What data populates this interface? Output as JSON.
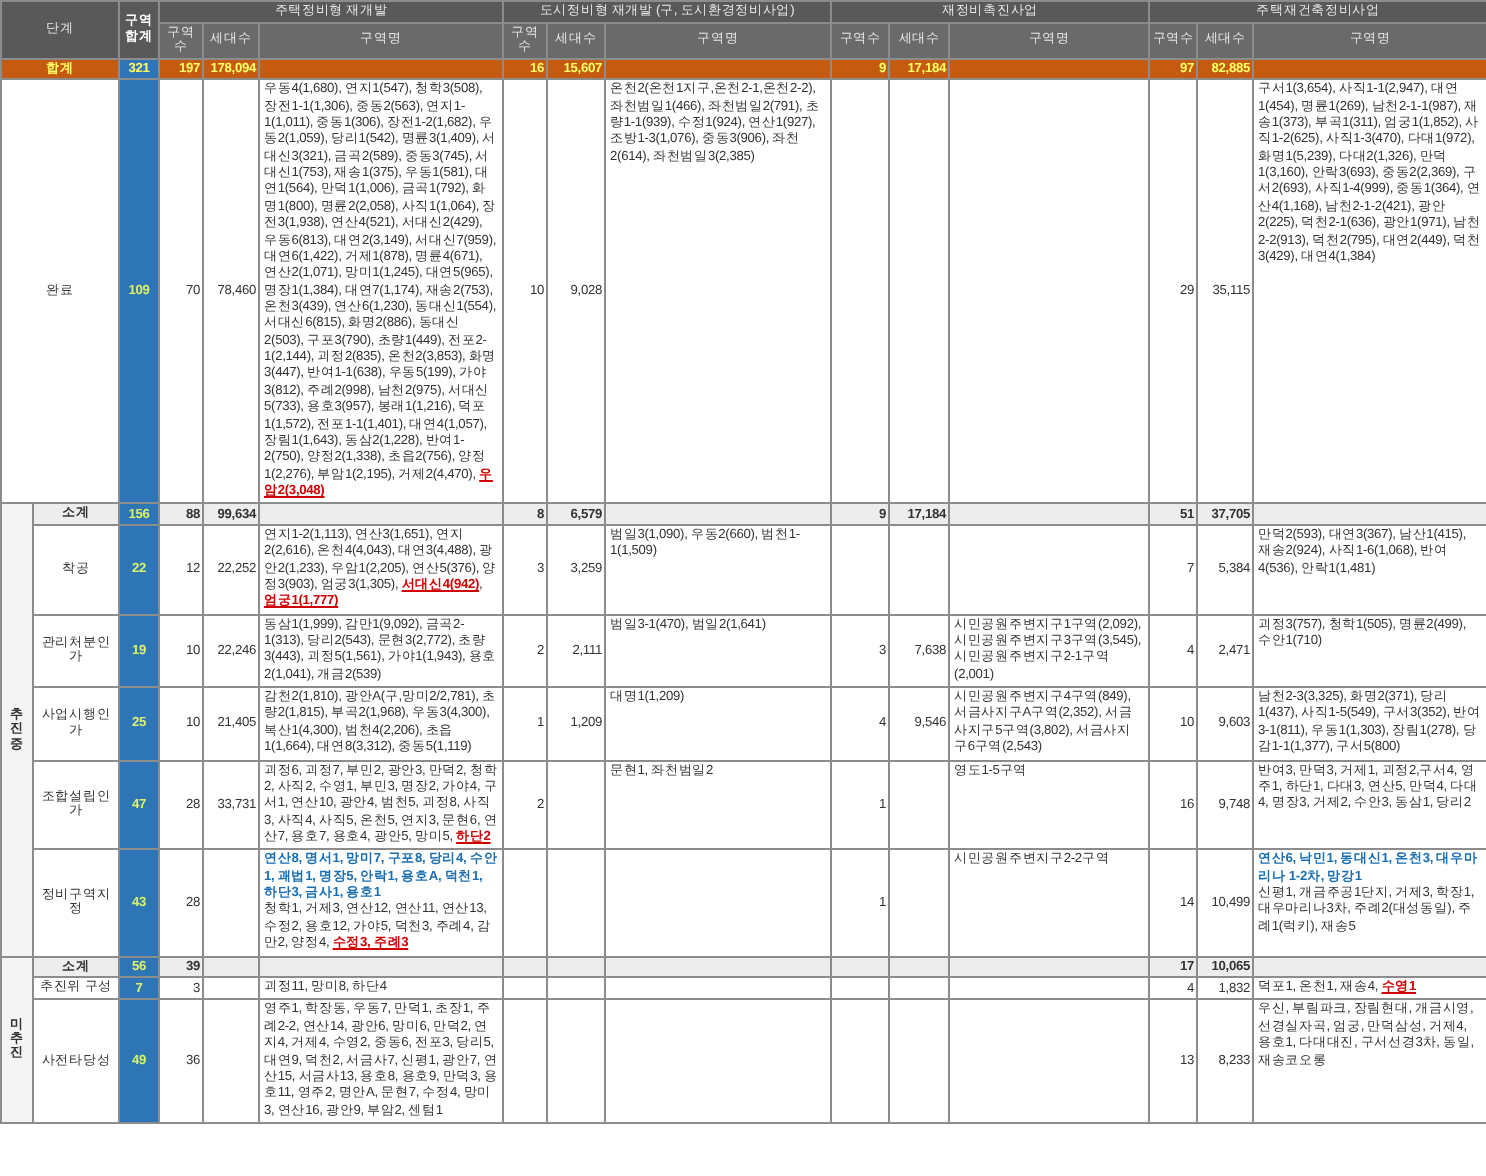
{
  "header": {
    "stage": "단계",
    "zone_total": "구역 합계"
  },
  "programs": [
    {
      "title": "주택정비형 재개발",
      "sub_headers": [
        "구역수",
        "세대수",
        "구역명"
      ]
    },
    {
      "title": "도시정비형 재개발 (구, 도시환경정비사업)",
      "sub_headers": [
        "구역수",
        "세대수",
        "구역명"
      ]
    },
    {
      "title": "재정비촉진사업",
      "sub_headers": [
        "구역수",
        "세대수",
        "구역명"
      ]
    },
    {
      "title": "주택재건축정비사업",
      "sub_headers": [
        "구역수",
        "세대수",
        "구역명"
      ]
    }
  ],
  "total": {
    "label": "합계",
    "zones": "321",
    "cells": [
      {
        "count": "197",
        "households": "178,094"
      },
      {
        "count": "16",
        "households": "15,607"
      },
      {
        "count": "9",
        "households": "17,184"
      },
      {
        "count": "97",
        "households": "82,885"
      }
    ]
  },
  "completed": {
    "label": "완료",
    "zones": "109",
    "cells": [
      {
        "count": "70",
        "households": "78,460",
        "districts": [
          [
            {
              "kind": "plain",
              "text": "우동4(1,680), 연지1(547), 청학3(508), 장전1-1(1,306), 중동2(563), 연지1-1(1,011), 중동1(306), 장전1-2(1,682), 우동2(1,059), 당리1(542), 명륜3(1,409), 서대신3(321), 금곡2(589), 중동3(745), 서대신1(753), 재송1(375), 우동1(581), 대연1(564), 만덕1(1,006), 금곡1(792), 화명1(800), 명륜2(2,058), 사직1(1,064), 장전3(1,938), 연산4(521), 서대신2(429), 우동6(813), 대연2(3,149), 서대신7(959), 대연6(1,422), 거제1(878), 명륜4(671), 연산2(1,071), 망미1(1,245), 대연5(965), 명장1(1,384), 대연7(1,174), 재송2(753), 온천3(439), 연산6(1,230), 동대신1(554), 서대신6(815), 화명2(886), 동대신2(503), 구포3(790), 초량1(449), 전포2-1(2,144), 괴정2(835), 온천2(3,853), 화명3(447), 반여1-1(638), 우동5(199), 가야3(812), 주례2(998), 남천2(975), 서대신5(733), 용호3(957), 봉래1(1,216), 덕포1(1,572), 전포1-1(1,401), 대연4(1,057), 장림1(1,643), 동삼2(1,228), 반여1-2(750), 양정2(1,338), 초읍2(756), 양정1(2,276), 부암1(2,195), 거제2(4,470), "
            },
            {
              "kind": "flagged",
              "text": "우암2(3,048)"
            }
          ]
        ]
      },
      {
        "count": "10",
        "households": "9,028",
        "districts": [
          [
            {
              "kind": "plain",
              "text": "온천2(온천1지구,온천2-1,온천2-2), 좌천범일1(466), 좌천범일2(791), 초량1-1(939), 수정1(924), 연산1(927), 조방1-3(1,076), 중동3(906), 좌천2(614), 좌천범일3(2,385)"
            }
          ]
        ]
      },
      {},
      {
        "count": "29",
        "households": "35,115",
        "districts": [
          [
            {
              "kind": "plain",
              "text": "구서1(3,654), 사직1-1(2,947), 대연1(454), 명륜1(269), 남천2-1-1(987), 재송1(373), 부곡1(311), 엄궁1(1,852), 사직1-2(625), 사직1-3(470), 다대1(972), 화명1(5,239), 다대2(1,326), 만덕1(3,160), 안락3(693), 중동2(2,369), 구서2(693), 사직1-4(999), 중동1(364), 연산4(1,168), 남천2-1-2(421), 광안2(225), 덕천2-1(636), 광안1(971), 남천2-2(913), 덕천2(795), 대연2(449), 덕천3(429), 대연4(1,384)"
            }
          ]
        ]
      }
    ]
  },
  "groups": [
    {
      "label": "추진중",
      "subtotal": {
        "label": "소계",
        "zones": "156",
        "cells": [
          {
            "count": "88",
            "households": "99,634"
          },
          {
            "count": "8",
            "households": "6,579"
          },
          {
            "count": "9",
            "households": "17,184"
          },
          {
            "count": "51",
            "households": "37,705"
          }
        ]
      },
      "rows": [
        {
          "label": "착공",
          "zones": "22",
          "cells": [
            {
              "count": "12",
              "households": "22,252",
              "districts": [
                [
                  {
                    "kind": "plain",
                    "text": "연지1-2(1,113), 연산3(1,651), 연지2(2,616), 온천4(4,043), 대연3(4,488), 광안2(1,233), 우암1(2,205), 연산5(376), 양정3(903), 엄궁3(1,305), "
                  },
                  {
                    "kind": "flagged",
                    "text": "서대신4(942)"
                  },
                  {
                    "kind": "plain",
                    "text": ", "
                  },
                  {
                    "kind": "flagged",
                    "text": "엄궁1(1,777)"
                  }
                ]
              ]
            },
            {
              "count": "3",
              "households": "3,259",
              "districts": [
                [
                  {
                    "kind": "plain",
                    "text": "범일3(1,090), 우동2(660), 범천1-1(1,509)"
                  }
                ]
              ]
            },
            {},
            {
              "count": "7",
              "households": "5,384",
              "districts": [
                [
                  {
                    "kind": "plain",
                    "text": "만덕2(593), 대연3(367), 남산1(415), 재송2(924), 사직1-6(1,068), 반여4(536), 안락1(1,481)"
                  }
                ]
              ]
            }
          ]
        },
        {
          "label": "관리처분인가",
          "zones": "19",
          "cells": [
            {
              "count": "10",
              "households": "22,246",
              "districts": [
                [
                  {
                    "kind": "plain",
                    "text": "동삼1(1,999), 감만1(9,092), 금곡2-1(313), 당리2(543), 문현3(2,772), 초량3(443), 괴정5(1,561), 가야1(1,943), 용호2(1,041), 개금2(539)"
                  }
                ]
              ]
            },
            {
              "count": "2",
              "households": "2,111",
              "districts": [
                [
                  {
                    "kind": "plain",
                    "text": "범일3-1(470), 범일2(1,641)"
                  }
                ]
              ]
            },
            {
              "count": "3",
              "households": "7,638",
              "districts": [
                [
                  {
                    "kind": "plain",
                    "text": "시민공원주변지구1구역(2,092), 시민공원주변지구3구역(3,545), 시민공원주변지구2-1구역(2,001)"
                  }
                ]
              ]
            },
            {
              "count": "4",
              "households": "2,471",
              "districts": [
                [
                  {
                    "kind": "plain",
                    "text": "괴정3(757), 청학1(505), 명륜2(499), 수안1(710)"
                  }
                ]
              ]
            }
          ]
        },
        {
          "label": "사업시행인가",
          "zones": "25",
          "cells": [
            {
              "count": "10",
              "households": "21,405",
              "districts": [
                [
                  {
                    "kind": "plain",
                    "text": "감천2(1,810), 광안A(구,망미2/2,781), 초량2(1,815), 부곡2(1,968), 우동3(4,300), 복산1(4,300), 범천4(2,206), 초읍1(1,664), 대연8(3,312), 중동5(1,119)"
                  }
                ]
              ]
            },
            {
              "count": "1",
              "households": "1,209",
              "districts": [
                [
                  {
                    "kind": "plain",
                    "text": "대명1(1,209)"
                  }
                ]
              ]
            },
            {
              "count": "4",
              "households": "9,546",
              "districts": [
                [
                  {
                    "kind": "plain",
                    "text": "시민공원주변지구4구역(849), 서금사지구A구역(2,352), 서금사지구5구역(3,802), 서금사지구6구역(2,543)"
                  }
                ]
              ]
            },
            {
              "count": "10",
              "households": "9,603",
              "districts": [
                [
                  {
                    "kind": "plain",
                    "text": "남천2-3(3,325), 화명2(371), 당리1(437), 사직1-5(549), 구서3(352), 반여3-1(811), 우동1(1,303), 장림1(278), 당감1-1(1,377), 구서5(800)"
                  }
                ]
              ]
            }
          ]
        },
        {
          "label": "조합설립인가",
          "zones": "47",
          "cells": [
            {
              "count": "28",
              "households": "33,731",
              "districts": [
                [
                  {
                    "kind": "plain",
                    "text": "괴정6, 괴정7, 부민2, 광안3, 만덕2, 청학2, 사직2, 수영1, 부민3, 명장2, 가야4, 구서1, 연산10, 광안4, 범천5, 괴정8, 사직3, 사직4, 사직5, 온천5, 연지3, 문현6, 연산7, 용호7, 용호4, 광안5, 망미5, "
                  },
                  {
                    "kind": "flagged",
                    "text": "하단2"
                  }
                ]
              ]
            },
            {
              "count": "2",
              "districts": [
                [
                  {
                    "kind": "plain",
                    "text": "문현1, 좌천범일2"
                  }
                ]
              ]
            },
            {
              "count": "1",
              "districts": [
                [
                  {
                    "kind": "plain",
                    "text": "영도1-5구역"
                  }
                ]
              ]
            },
            {
              "count": "16",
              "households": "9,748",
              "districts": [
                [
                  {
                    "kind": "plain",
                    "text": "반여3, 만덕3, 거제1, 괴정2,구서4, 영주1, 하단1, 다대3, 연산5, 만덕4, 다대4, 명장3, 거제2, 수안3, 동삼1, 당리2"
                  }
                ]
              ]
            }
          ]
        },
        {
          "label": "정비구역지정",
          "zones": "43",
          "cells": [
            {
              "count": "28",
              "districts": [
                [
                  {
                    "kind": "new",
                    "text": "연산8, 명서1, 망미7, 구포8, 당리4, 수안1, 괘법1, 명장5, 안락1, 용호A, 덕천1, 하단3, 금사1, 용호1"
                  }
                ],
                [
                  {
                    "kind": "plain",
                    "text": "청학1, 거제3, 연산12, 연산11, 연산13, 수정2, 용호12, 가야5, 덕천3, 주례4, 감만2, 양정4, "
                  },
                  {
                    "kind": "flagged",
                    "text": "수정3, 주례3"
                  }
                ]
              ]
            },
            {},
            {
              "count": "1",
              "districts": [
                [
                  {
                    "kind": "plain",
                    "text": "시민공원주변지구2-2구역"
                  }
                ]
              ]
            },
            {
              "count": "14",
              "households": "10,499",
              "districts": [
                [
                  {
                    "kind": "new",
                    "text": "연산6, 낙민1, 동대신1, 온천3, 대우마리나 1-2차, 망강1"
                  }
                ],
                [
                  {
                    "kind": "plain",
                    "text": "신평1, 개금주공1단지, 거제3, 학장1, 대우마리나3차, 주례2(대성동일), 주례1(럭키), 재송5"
                  }
                ]
              ]
            }
          ]
        }
      ]
    },
    {
      "label": "미추진",
      "subtotal": {
        "label": "소계",
        "zones": "56",
        "cells": [
          {
            "count": "39"
          },
          {},
          {},
          {
            "count": "17",
            "households": "10,065"
          }
        ]
      },
      "rows": [
        {
          "label": "추진위 구성",
          "zones": "7",
          "cells": [
            {
              "count": "3",
              "districts": [
                [
                  {
                    "kind": "plain",
                    "text": "괴정11, 망미8, 하단4"
                  }
                ]
              ]
            },
            {},
            {},
            {
              "count": "4",
              "households": "1,832",
              "districts": [
                [
                  {
                    "kind": "plain",
                    "text": "덕포1, 온천1, 재송4, "
                  },
                  {
                    "kind": "flagged",
                    "text": "수영1"
                  }
                ]
              ]
            }
          ]
        },
        {
          "label": "사전타당성",
          "zones": "49",
          "cells": [
            {
              "count": "36",
              "districts": [
                [
                  {
                    "kind": "plain",
                    "text": "영주1, 학장동, 우동7, 만덕1, 초장1, 주례2-2, 연산14, 광안6, 망미6, 만덕2, 연지4, 거제4, 수영2, 중동6, 전포3, 당리5, 대연9, 덕천2, 서금사7, 신평1, 광안7, 연산15, 서금사13, 용호8, 용호9, 만덕3, 용호11, 영주2, 명안A, 문현7, 수정4, 망미3, 연산16, 광안9, 부암2, 센텀1"
                  }
                ]
              ]
            },
            {},
            {},
            {
              "count": "13",
              "households": "8,233",
              "districts": [
                [
                  {
                    "kind": "plain",
                    "text": "우신, 부림파크, 장림현대, 개금시영, 선경실자곡, 엄궁, 만덕삼성, 거제4, 용호1, 다대대진, 구서선경3차, 동일, 재송코오롱"
                  }
                ]
              ]
            }
          ]
        }
      ]
    }
  ]
}
